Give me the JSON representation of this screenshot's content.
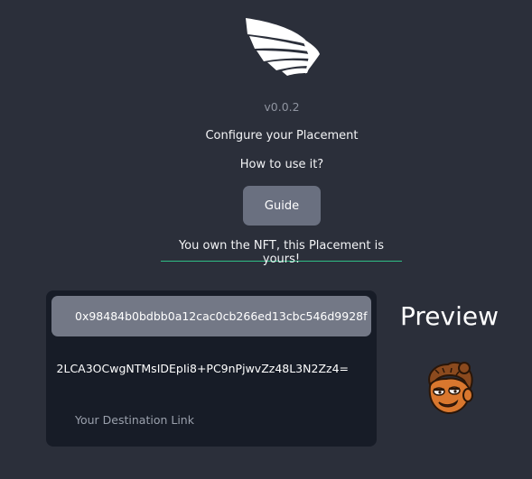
{
  "app": {
    "version": "v0.0.2",
    "configure_text": "Configure your Placement",
    "how_to_text": "How to use it?",
    "guide_button": "Guide",
    "ownership_message": "You own the NFT, this Placement is yours!",
    "logo_icon": "wing-icon"
  },
  "form": {
    "contract_address": "0x98484b0bdbb0a12cac0cb266ed13cbc546d9928f",
    "encoded_image": "2LCA3OCwgNTMsIDEpIi8+PC9nPjwvZz48L3N2Zz4=",
    "destination_placeholder": "Your Destination Link"
  },
  "preview": {
    "title": "Preview",
    "image_icon": "cartoon-avatar-icon"
  },
  "colors": {
    "background": "#2b2f3a",
    "panel": "#171c27",
    "active_field": "#737886",
    "button": "#6a7080",
    "underline_accent": "#2fbf86"
  }
}
